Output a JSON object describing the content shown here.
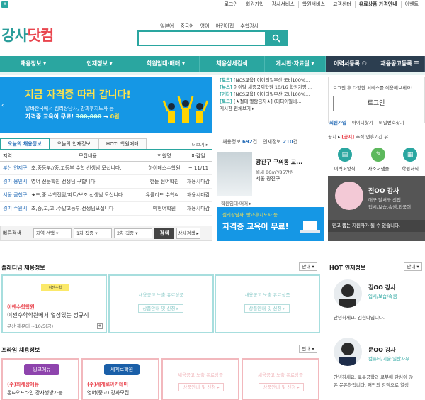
{
  "topbar": {
    "links": [
      "로그인",
      "회원가입",
      "강사서비스",
      "학원서비스",
      "고객센터",
      "유료상품 가격안내",
      "이벤트"
    ]
  },
  "logo": {
    "text_a": "강사",
    "text_b": "닷컴"
  },
  "quick_links": [
    "일본어",
    "중국어",
    "영어",
    "어린이집",
    "수학강사"
  ],
  "search": {
    "placeholder": ""
  },
  "nav": [
    "채용정보 ▾",
    "인재정보 ▾",
    "학원임대·매매 ▾",
    "채용상세검색",
    "게시판·자료실 ▾",
    "이력서등록",
    "채용공고등록"
  ],
  "banner": {
    "title": "지금 자격증 따러 갑니다!",
    "line1": "알바한국에서 심리상담사, 방과후지도사 등",
    "line2_a": "자격증 교육이 무료! ",
    "line2_strike": "300,000",
    "line2_b": " → ",
    "line2_zero": "0원"
  },
  "notices": [
    {
      "tag": "[토크]",
      "text": " [NCS교육] 이이티일부산 국비100%..."
    },
    {
      "tag": "[뉴스]",
      "text": " 아이탈 세종국제학원 10/16 학원가령 ..."
    },
    {
      "tag": "[기타]",
      "text": " [NCS교육] 이이티일부산 국비100%..."
    },
    {
      "tag": "[토크]",
      "text": " [★절대 열람금지★] (미디어밀네..."
    },
    {
      "tag": "",
      "text": "게시판 전체보기 ▸"
    }
  ],
  "stats": {
    "jobs_label": "채용정보",
    "jobs_value": "692",
    "unit": "건",
    "talent_label": "인재정보",
    "talent_value": "210"
  },
  "tabs": {
    "items": [
      "오늘의 채용정보",
      "오늘의 인재정보",
      "HOT! 학원매매"
    ],
    "more": "더보기 ▸"
  },
  "table": {
    "headers": [
      "지역",
      "모집내용",
      "학원명",
      "마감일"
    ],
    "rows": [
      [
        "부산 연제구",
        "초,중등부//중,고등부 수학 선생님 모십니다.",
        "하이매스수학원",
        "~ 11/11"
      ],
      [
        "경기 용인시",
        "영어 전문학원 선생님 구합니다",
        "헌듄 전어학원",
        "채용시마감"
      ],
      [
        "서울 금천구",
        "★초,중 수학전임/파트/보조 선생님 모십니다.",
        "유클리드 수학&...",
        "채용시마감"
      ],
      [
        "경기 수원시",
        "초,중,고,고..주말고등부.선생님모십니다",
        "박현어학원",
        "채용시마감"
      ]
    ]
  },
  "filter": {
    "label": "빠른검색",
    "sel1": "지역 선택 ▾",
    "sel2": "1차 직종 ▾",
    "sel3": "2차 직종 ▾",
    "search": "검색",
    "detail": "상세검색 ▸"
  },
  "card": {
    "title": "광진구 구의동 교...",
    "line1": "월세 86m²/85만원",
    "line2": "서울 광진구",
    "footer": "학원임대·매매 ▸"
  },
  "ad2": {
    "line1": "심리상담사, 방과후지도사 등",
    "line2": "자격증 교육이 무료!"
  },
  "login": {
    "msg": "로그인 후 다양한 서비스를 이용해보세요!",
    "button": "로그인",
    "links": [
      "회원가입",
      "아이디찾기",
      "비밀번호찾기"
    ]
  },
  "fav": {
    "prefix": "공지 ▸ ",
    "tag": "[공지]",
    "text": " 추석 연휴기간 유 ..."
  },
  "icons3": [
    {
      "label": "이력서양식",
      "color": "#2aa6a0"
    },
    {
      "label": "자소서샘플",
      "color": "#5cb85c"
    },
    {
      "label": "학원서식",
      "color": "#2aa6a0"
    }
  ],
  "hot_card": {
    "name": "전OO 강사",
    "sub1": "대구 달서구   신입",
    "sub2": "입시/보습,속셈,외국어",
    "footer": "믿고 뽑는 지원자가 될 수 있습니다."
  },
  "platinum": {
    "title": "플래티넘 채용정보",
    "more": "안내 ▾",
    "featured": {
      "logo": "이젠수학",
      "name": "이젠수학학원",
      "desc": "이젠수학학원에서 열정있는 정규직",
      "loc": "부산·해운대  ~10/5(금)"
    },
    "placeholder": {
      "a": "채용공고 노출 유료상품",
      "b": "상품안내 및 신청 ▸"
    }
  },
  "hot_talent": {
    "title": "HOT 인재정보",
    "more": "안내 ▾",
    "people": [
      {
        "name": "김OO 강사",
        "sub": "입시/보습/속셈",
        "desc": "안녕하세요. 김현나입니다."
      },
      {
        "name": "문OO 강사",
        "sub": "컴퓨터/기술·일반사무",
        "desc": "안녕하세요. 로봇공학과 로봇에 관심이 많",
        "desc2": "은 문은하입니다. 저만의 강점으로 열성"
      }
    ]
  },
  "prime": {
    "title": "프라임 채용정보",
    "more": "안내 ▾",
    "items": [
      {
        "logo": "잉크에듀",
        "name": "(주)회세상에듀",
        "desc": "온&오프라인 강사생방가능",
        "color": "#8e44ad"
      },
      {
        "logo": "세계로학원",
        "name": "(주)세계로아카데미",
        "desc": "영어(중고) 강사모집",
        "color": "#1a5fa8"
      }
    ],
    "placeholder": {
      "a": "채용공고 노출 유료상품",
      "b": "상품안내 및 신청 ▸"
    }
  }
}
